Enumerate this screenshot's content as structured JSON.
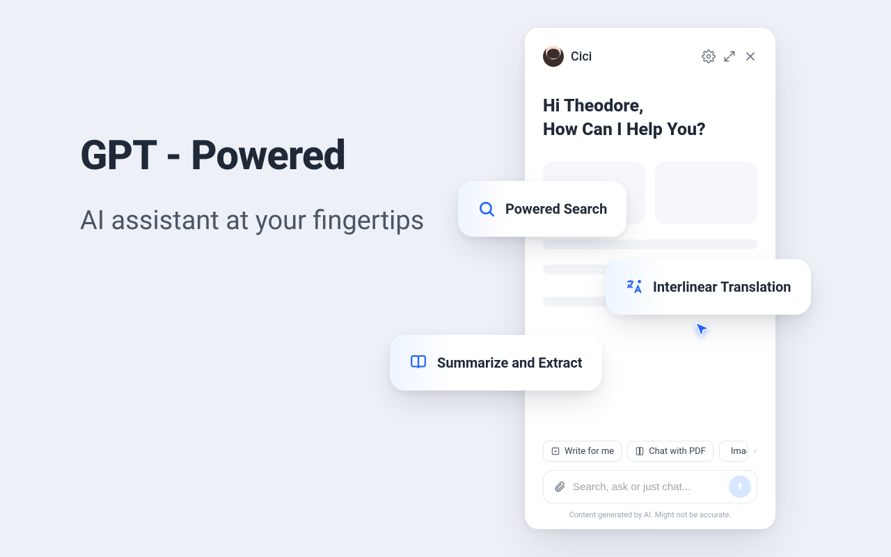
{
  "hero": {
    "title": "GPT - Powered",
    "subtitle": "AI assistant at your fingertips"
  },
  "panel": {
    "assistant_name": "Cici",
    "greeting_line1": "Hi Theodore,",
    "greeting_line2": "How Can I Help You?",
    "chips": {
      "write": "Write for me",
      "pdf": "Chat with PDF",
      "image": "Image"
    },
    "search_placeholder": "Search, ask or just chat...",
    "disclaimer": "Content generated by AI. Might not be accurate."
  },
  "pills": {
    "search": "Powered Search",
    "translate": "Interlinear Translation",
    "summarize": "Summarize and Extract"
  }
}
